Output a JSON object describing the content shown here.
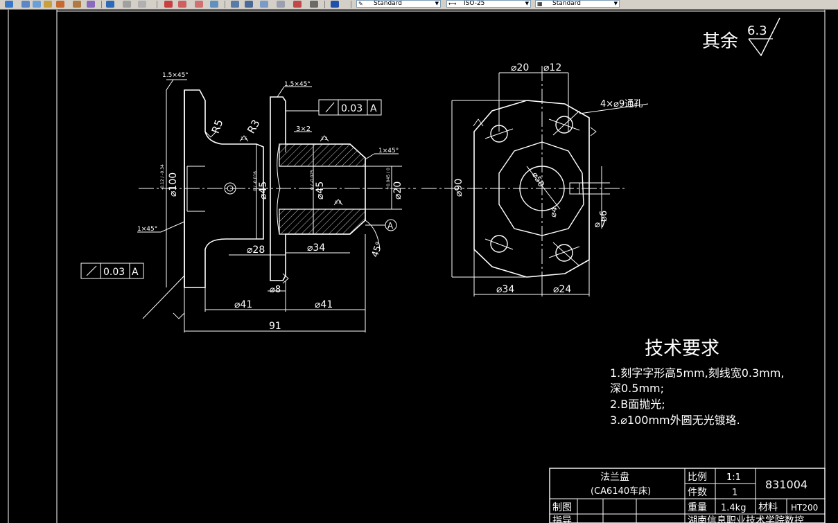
{
  "toolbar": {
    "text_style": "Standard",
    "dim_style": "ISO-25",
    "table_style": "Standard"
  },
  "colors": {
    "background": "#000000",
    "line": "#ffffff",
    "toolbar": "#d4d0c8"
  },
  "drawing": {
    "roughness_prefix": "其余",
    "roughness_value": "6.3",
    "front_view": {
      "chamfer_top_left": "1.5×45°",
      "chamfer_top_mid": "1.5×45°",
      "chamfer_right": "1×45°",
      "chamfer_left": "1×45°",
      "radius_1": "R5",
      "radius_2": "R3",
      "groove": "3×2",
      "tol_top_value": "0.03",
      "tol_top_ref": "A",
      "tol_left_value": "0.03",
      "tol_left_ref": "A",
      "d100": "⌀100",
      "d100_tol": "-0.12 / -0.34",
      "d45a": "⌀45",
      "d45a_tol": "0 / -0.016",
      "d45b": "⌀45",
      "d45b_tol": "0 / -0.025",
      "d20": "⌀20",
      "d20_tol": "+0.045 / 0",
      "d28": "⌀28",
      "d34": "⌀34",
      "d8": "⌀8",
      "d41a": "⌀41",
      "d41b": "⌀41",
      "length_91": "91",
      "angle_45": "45°",
      "datum": "A",
      "rough_08": "0.8",
      "rough_16": "1.6",
      "rough_32": "3.2"
    },
    "side_view": {
      "d20": "⌀20",
      "d12": "⌀12",
      "holes": "4×⌀9通孔",
      "d90": "⌀90",
      "d34": "⌀34",
      "d24": "⌀24",
      "d6": "⌀6",
      "d7": "⌀7",
      "d50": "⌀50",
      "d4": "⌀4"
    },
    "requirements": {
      "title": "技术要求",
      "line1": "1.刻字字形高5mm,刻线宽0.3mm,",
      "line2": "深0.5mm;",
      "line3": "2.B面抛光;",
      "line4": "3.⌀100mm外圆无光镀珞."
    },
    "title_block": {
      "part_name": "法兰盘",
      "machine": "(CA6140车床)",
      "scale_label": "比例",
      "scale_value": "1:1",
      "qty_label": "件数",
      "qty_value": "1",
      "drawing_no": "831004",
      "drawn_label": "制图",
      "weight_label": "重量",
      "weight_value": "1.4kg",
      "material_label": "材料",
      "material_value": "HT200",
      "guide_label": "指导",
      "school": "湖南信息职业技术学院数控"
    }
  }
}
